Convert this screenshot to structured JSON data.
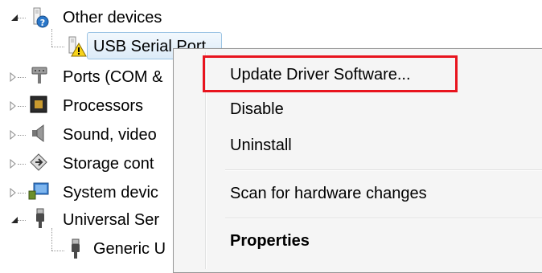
{
  "tree": {
    "items": [
      {
        "label": "Other devices",
        "icon": "unknown-device-icon",
        "expanded": true
      },
      {
        "label": "USB Serial Port",
        "icon": "warning-device-icon",
        "selected": true
      },
      {
        "label": "Ports (COM &",
        "icon": "port-icon",
        "expanded": false
      },
      {
        "label": "Processors",
        "icon": "processor-icon",
        "expanded": false
      },
      {
        "label": "Sound, video",
        "icon": "speaker-icon",
        "expanded": false
      },
      {
        "label": "Storage cont",
        "icon": "storage-icon",
        "expanded": false
      },
      {
        "label": "System devic",
        "icon": "system-device-icon",
        "expanded": false
      },
      {
        "label": "Universal Ser",
        "icon": "usb-icon",
        "expanded": true
      },
      {
        "label": "Generic U",
        "icon": "usb-icon"
      }
    ]
  },
  "context_menu": {
    "items": [
      {
        "label": "Update Driver Software..."
      },
      {
        "label": "Disable"
      },
      {
        "label": "Uninstall"
      },
      {
        "label": "Scan for hardware changes"
      },
      {
        "label": "Properties"
      }
    ],
    "highlight_color": "#e8141e"
  }
}
